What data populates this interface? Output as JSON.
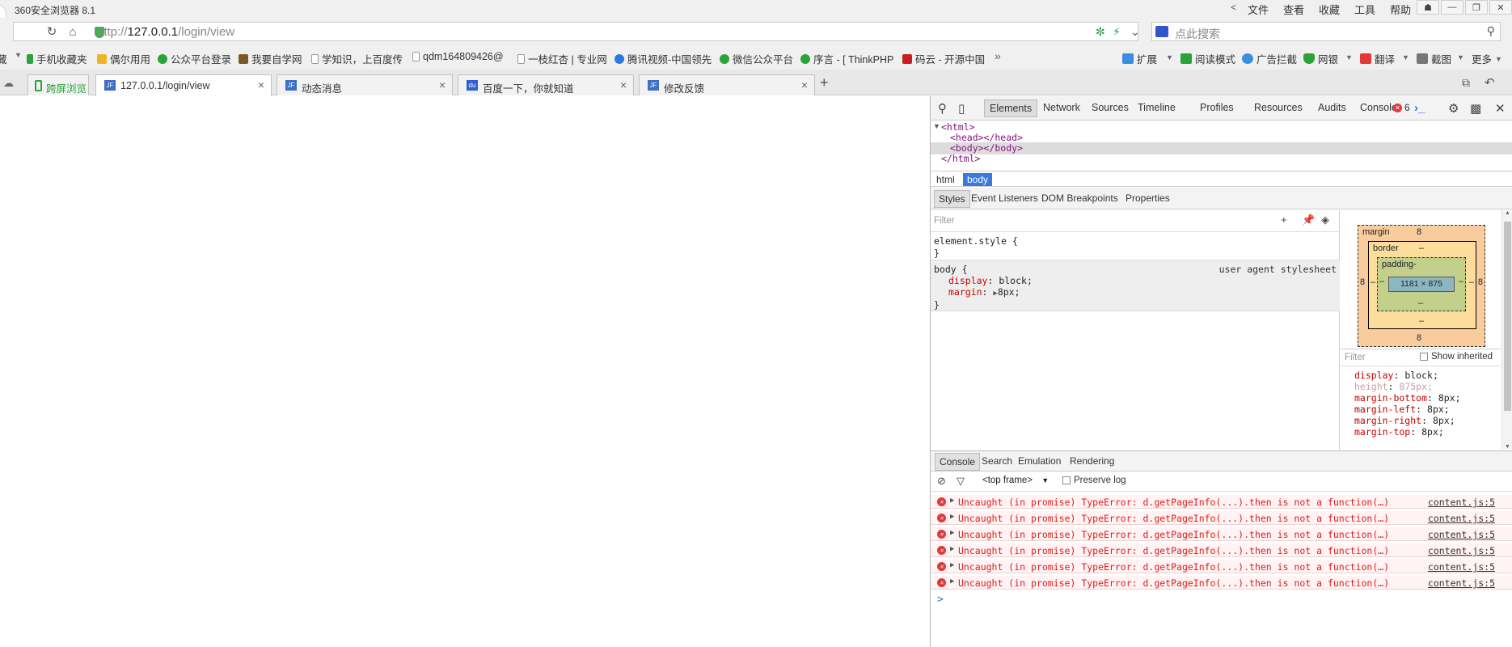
{
  "window": {
    "app_title": "360安全浏览器 8.1",
    "menu_nav": "<",
    "menu": [
      "文件",
      "查看",
      "收藏",
      "工具",
      "帮助"
    ],
    "controls": [
      "☗",
      "—",
      "❐",
      "✕"
    ]
  },
  "address": {
    "url_scheme": "http://",
    "url_host": "127.0.0.1",
    "url_path": "/login/view",
    "search_placeholder": "点此搜索"
  },
  "bookmarks": {
    "left_edge": "藏",
    "items": [
      {
        "label": "手机收藏夹",
        "color": "#2aa33a"
      },
      {
        "label": "偶尔用用",
        "color": "#f0b429"
      },
      {
        "label": "公众平台登录",
        "color": "#2aa33a"
      },
      {
        "label": "我要自学网",
        "color": "#7a5a2a"
      },
      {
        "label": "学知识，上百度传",
        "color": "#ffffff"
      },
      {
        "label": "qdm164809426@",
        "color": "#ffffff"
      },
      {
        "label": "一枝红杏 | 专业网",
        "color": "#ffffff"
      },
      {
        "label": "腾讯视频-中国领先",
        "color": "#2a7ae2"
      },
      {
        "label": "微信公众平台",
        "color": "#2aa33a"
      },
      {
        "label": "序言 - [ ThinkPHP",
        "color": "#2aa33a"
      },
      {
        "label": "码云 - 开源中国",
        "color": "#c71d23"
      }
    ],
    "overflow": "»",
    "tools": [
      {
        "label": "扩展",
        "color": "#3b8de0"
      },
      {
        "label": "阅读模式",
        "color": "#2aa33a"
      },
      {
        "label": "广告拦截",
        "color": "#3b8de0"
      },
      {
        "label": "网银",
        "color": "#2aa33a"
      },
      {
        "label": "翻译",
        "color": "#e23838"
      },
      {
        "label": "截图",
        "color": "#666666"
      },
      {
        "label": "更多",
        "color": "#666666"
      }
    ]
  },
  "tabs": {
    "kuaping": "跨屏浏览",
    "items": [
      {
        "label": "127.0.0.1/login/view",
        "active": true,
        "fav": "JF"
      },
      {
        "label": "动态消息",
        "active": false,
        "fav": "JF"
      },
      {
        "label": "百度一下，你就知道",
        "active": false,
        "fav": "du"
      },
      {
        "label": "修改反馈",
        "active": false,
        "fav": "JF"
      }
    ],
    "new_tab": "+"
  },
  "devtools": {
    "tabs": [
      "Elements",
      "Network",
      "Sources",
      "Timeline",
      "Profiles",
      "Resources",
      "Audits",
      "Console"
    ],
    "error_count": "6",
    "dom": [
      "<html>",
      "<head></head>",
      "<body></body>",
      "</html>"
    ],
    "breadcrumbs": [
      "html",
      "body"
    ],
    "style_tabs": [
      "Styles",
      "Event Listeners",
      "DOM Breakpoints",
      "Properties"
    ],
    "styles_filter": "Filter",
    "element_style": {
      "selector": "element.style {",
      "close": "}"
    },
    "body_rule": {
      "selector": "body {",
      "source": "user agent stylesheet",
      "props": [
        {
          "name": "display",
          "value": "block;"
        },
        {
          "name": "margin",
          "value": "8px;"
        }
      ],
      "close": "}"
    },
    "box_model": {
      "margin_label": "margin",
      "margin_value": "8",
      "margin_bottom": "8",
      "margin_left": "8",
      "margin_right": "8",
      "border_label": "border",
      "border_value": "–",
      "padding_label": "padding-",
      "dash": "–",
      "content": "1181 × 875"
    },
    "computed_filter": "Filter",
    "show_inherited": "Show inherited",
    "computed": [
      {
        "name": "display",
        "value": "block;",
        "dim": false
      },
      {
        "name": "height",
        "value": "875px;",
        "dim": true
      },
      {
        "name": "margin-bottom",
        "value": "8px;",
        "dim": false
      },
      {
        "name": "margin-left",
        "value": "8px;",
        "dim": false
      },
      {
        "name": "margin-right",
        "value": "8px;",
        "dim": false
      },
      {
        "name": "margin-top",
        "value": "8px;",
        "dim": false
      }
    ],
    "console_tabs": [
      "Console",
      "Search",
      "Emulation",
      "Rendering"
    ],
    "frame": "<top frame>",
    "preserve_log": "Preserve log",
    "messages": [
      {
        "text": "Uncaught (in promise) TypeError: d.getPageInfo(...).then is not a function(…)",
        "source": "content.js:5"
      },
      {
        "text": "Uncaught (in promise) TypeError: d.getPageInfo(...).then is not a function(…)",
        "source": "content.js:5"
      },
      {
        "text": "Uncaught (in promise) TypeError: d.getPageInfo(...).then is not a function(…)",
        "source": "content.js:5"
      },
      {
        "text": "Uncaught (in promise) TypeError: d.getPageInfo(...).then is not a function(…)",
        "source": "content.js:5"
      },
      {
        "text": "Uncaught (in promise) TypeError: d.getPageInfo(...).then is not a function(…)",
        "source": "content.js:5"
      },
      {
        "text": "Uncaught (in promise) TypeError: d.getPageInfo(...).then is not a function(…)",
        "source": "content.js:5"
      }
    ],
    "prompt": ">"
  }
}
